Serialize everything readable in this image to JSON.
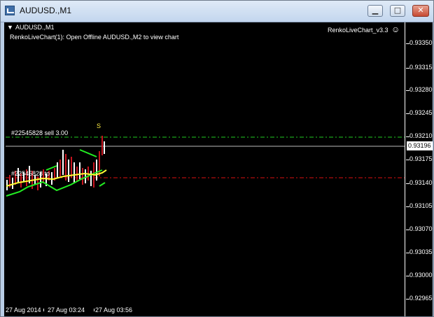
{
  "window": {
    "title": "AUDUSD.,M1",
    "buttons": {
      "minimize": "▁",
      "maximize": "□",
      "close": "✕"
    }
  },
  "chart": {
    "symbol_label": "AUDUSD.,M1",
    "indicator_message": "RenkoLiveChart(1): Open Offline AUDUSD.,M2 to view chart",
    "ea_name": "RenkoLiveChart_v3.3",
    "order_sell_label": "#22545828 sell 3.00",
    "order_tp_label": "#22545828 tp",
    "marker_s": "S",
    "current_price": "0.93196",
    "price_labels": [
      "0.93350",
      "0.93315",
      "0.93280",
      "0.93245",
      "0.93210",
      "0.93175",
      "0.93140",
      "0.93105",
      "0.93070",
      "0.93035",
      "0.93000",
      "0.92965"
    ],
    "time_labels": [
      "27 Aug 2014",
      "27 Aug 03:24",
      "27 Aug 03:56"
    ]
  },
  "colors": {
    "background": "#000000",
    "up_candle": "#ffffff",
    "down_candle": "#c8141e",
    "ma": "#ffff33",
    "bands": "#22ee22",
    "sell_line": "#22cc22",
    "tp_line": "#dd1111"
  }
}
